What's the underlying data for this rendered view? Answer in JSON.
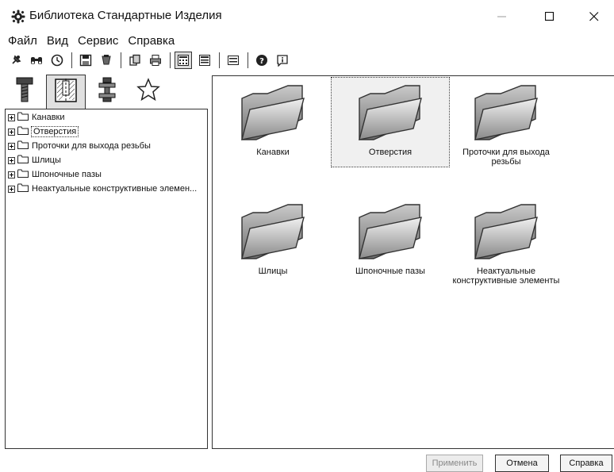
{
  "window": {
    "title": "Библиотека Стандартные Изделия",
    "icon": "gear-icon"
  },
  "menu": [
    "Файл",
    "Вид",
    "Сервис",
    "Справка"
  ],
  "toolbar_icons": [
    "pin-icon",
    "binoculars-icon",
    "clock-icon",
    "save-icon",
    "settings-icon",
    "copy-icon",
    "print-icon",
    "view-large-icons-icon",
    "view-small-icons-icon",
    "view-list-icon",
    "help-icon",
    "info-icon"
  ],
  "tabs": [
    {
      "icon": "bolt-icon",
      "selected": false
    },
    {
      "icon": "hole-section-icon",
      "selected": true
    },
    {
      "icon": "nut-washer-icon",
      "selected": false
    },
    {
      "icon": "star-icon",
      "selected": false
    }
  ],
  "tree": [
    {
      "label": "Канавки"
    },
    {
      "label": "Отверстия",
      "focused": true
    },
    {
      "label": "Проточки для выхода резьбы"
    },
    {
      "label": "Шлицы"
    },
    {
      "label": "Шпоночные пазы"
    },
    {
      "label": "Неактуальные конструктивные элемен..."
    }
  ],
  "items": [
    {
      "line1": "Канавки",
      "line2": ""
    },
    {
      "line1": "Отверстия",
      "line2": "",
      "selected": true
    },
    {
      "line1": "Проточки для выхода",
      "line2": "резьбы"
    },
    {
      "line1": "Шлицы",
      "line2": ""
    },
    {
      "line1": "Шпоночные пазы",
      "line2": ""
    },
    {
      "line1": "Неактуальные",
      "line2": "конструктивные элементы"
    }
  ],
  "buttons": {
    "apply": "Применить",
    "cancel": "Отмена",
    "help": "Справка"
  }
}
